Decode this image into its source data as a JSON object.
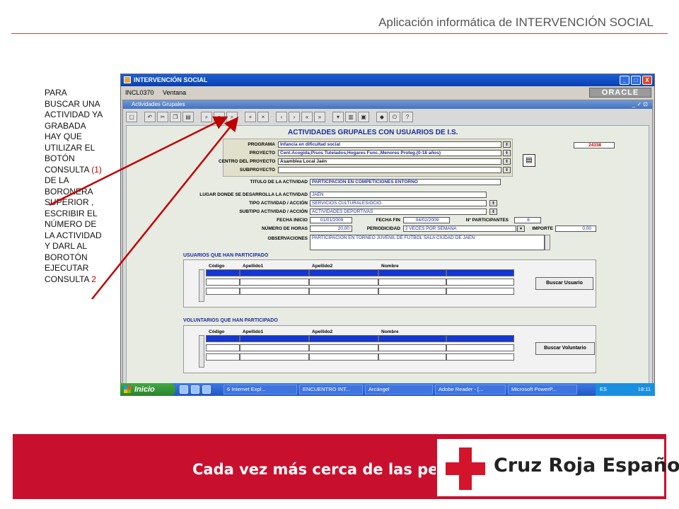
{
  "header": {
    "title": "Aplicación informática de INTERVENCIÓN SOCIAL"
  },
  "note": {
    "text_black": "PARA BUSCAR UNA ACTIVIDAD YA GRABADA HAY QUE UTILIZAR  EL BOTÓN CONSULTA ",
    "marker1": "(1)",
    "text_black2": " DE LA BORONERA SUPERIOR , ESCRIBIR EL NÚMERO DE LA ACTIVIDAD Y DARL AL BOROTÓN EJECUTAR CONSULTA ",
    "marker2": "2"
  },
  "window": {
    "title": "INTERVENCIÓN SOCIAL",
    "controls": [
      "_",
      "□",
      "X"
    ],
    "menu": [
      "INCL0370",
      "Ventana"
    ],
    "brand": "ORACLE",
    "subwindow_title": "Actividades Grupales",
    "subwindow_controls": "_ ✓ ⊡"
  },
  "toolbar": {
    "buttons": [
      {
        "name": "save",
        "icon": "save-icon",
        "glyph": "▢"
      },
      {
        "name": "undo",
        "icon": "undo-icon",
        "glyph": "↶"
      },
      {
        "name": "cut",
        "icon": "cut-icon",
        "glyph": "✂"
      },
      {
        "name": "copy",
        "icon": "copy-icon",
        "glyph": "❐"
      },
      {
        "name": "paste",
        "icon": "paste-icon",
        "glyph": "▤"
      },
      {
        "name": "enter-query",
        "icon": "query-icon",
        "glyph": "⌕"
      },
      {
        "name": "execute-query",
        "icon": "execute-query-icon",
        "glyph": "⌕"
      },
      {
        "name": "cancel-query",
        "icon": "cancel-query-icon",
        "glyph": "⌕"
      },
      {
        "name": "insert-record",
        "icon": "insert-record-icon",
        "glyph": "+"
      },
      {
        "name": "delete-record",
        "icon": "delete-record-icon",
        "glyph": "×"
      },
      {
        "name": "prev-record",
        "icon": "prev-icon",
        "glyph": "‹"
      },
      {
        "name": "next-record",
        "icon": "next-icon",
        "glyph": "›"
      },
      {
        "name": "prev-block",
        "icon": "prev-block-icon",
        "glyph": "«"
      },
      {
        "name": "next-block",
        "icon": "next-block-icon",
        "glyph": "»"
      },
      {
        "name": "list",
        "icon": "list-icon",
        "glyph": "▾"
      },
      {
        "name": "edit",
        "icon": "edit-icon",
        "glyph": "▥"
      },
      {
        "name": "attach",
        "icon": "attach-icon",
        "glyph": "▣"
      },
      {
        "name": "tools",
        "icon": "tools-icon",
        "glyph": "◆"
      },
      {
        "name": "exit",
        "icon": "exit-icon",
        "glyph": "⏻"
      },
      {
        "name": "help",
        "icon": "help-icon",
        "glyph": "?"
      }
    ]
  },
  "form": {
    "heading": "ACTIVIDADES GRUPALES CON USUARIOS DE I.S.",
    "record_number": "24338",
    "programa_label": "PROGRAMA",
    "programa": "Infancia en dificultad social",
    "proyecto_label": "PROYECTO",
    "proyecto": "Cent.Acogida,Pisos Tutelados,Hogares Func.,Menores Proteg.(0-18 años)",
    "centro_label": "CENTRO DEL PROYECTO",
    "centro": "Asamblea Local Jaén",
    "subproyecto_label": "SUBPROYECTO",
    "subproyecto": "",
    "titulo_label": "TITULO DE LA ACTIVIDAD",
    "titulo": "PARTICPACIÓN EN COMPETICIONES ENTORNO",
    "lugar_label": "LUGAR DONDE SE DESARROLLA LA ACTIVIDAD",
    "lugar": "JAÉN",
    "tipo_label": "TIPO ACTIVIDAD / ACCIÓN",
    "tipo": "SERVICIOS CULTURALES/OCIO",
    "subtipo_label": "SUBTIPO ACTIVIDAD / ACCIÓN",
    "subtipo": "ACTIVIDADES DEPORTIVAS",
    "fecha_inicio_label": "FECHA INICIO",
    "fecha_inicio": "01/01/2009",
    "fecha_fin_label": "FECHA FIN",
    "fecha_fin": "04/02/2009",
    "participantes_label": "Nº PARTICIPANTES",
    "participantes": "6",
    "horas_label": "NÚMERO DE HORAS",
    "horas": "20,00",
    "periodicidad_label": "PERIODICIDAD",
    "periodicidad": "2 VECES POR SEMANA",
    "importe_label": "IMPORTE",
    "importe": "0,00",
    "observaciones_label": "OBSERVACIONES",
    "observaciones": "PARTICIPACIÓN EN TORNEO JUVENIL DE FUTBOL SALA CIUDAD DE JAEN"
  },
  "usuarios": {
    "title": "USUARIOS QUE HAN PARTICIPADO",
    "columns": [
      "Código",
      "Apellido1",
      "Apellido2",
      "Nombre"
    ],
    "button": "Buscar Usuario"
  },
  "voluntarios": {
    "title": "VOLUNTARIOS QUE HAN PARTICIPADO",
    "columns": [
      "Código",
      "Apellido1",
      "Apellido2",
      "Nombre"
    ],
    "button": "Buscar Voluntario"
  },
  "taskbar": {
    "start": "Inicio",
    "tasks": [
      "6 Internet Expl...",
      "ENCUENTRO INT...",
      "Arcángel",
      "Adobe Reader - [...",
      "Microsoft PowerP..."
    ],
    "lang": "ES",
    "clock": "18:11"
  },
  "footer": {
    "slogan": "Cada vez más cerca de las personas",
    "brand": "Cruz Roja Española"
  },
  "colors": {
    "brand_red": "#c8102e",
    "xp_blue": "#2356c2",
    "oracle_field_blue": "#1c2a9c"
  }
}
